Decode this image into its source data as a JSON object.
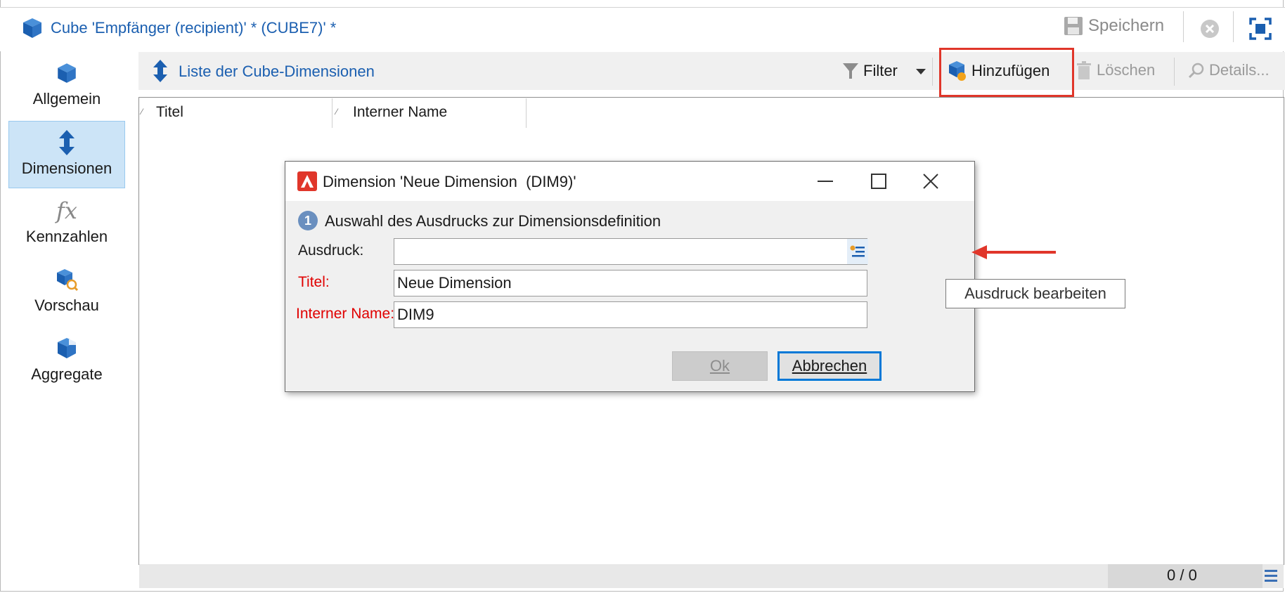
{
  "window": {
    "title": "Cube 'Empfänger (recipient)' * (CUBE7)' *",
    "save_label": "Speichern"
  },
  "nav": {
    "items": [
      {
        "label": "Allgemein",
        "icon": "cube-icon"
      },
      {
        "label": "Dimensionen",
        "icon": "updown-arrow-icon",
        "active": true
      },
      {
        "label": "Kennzahlen",
        "icon": "fx-icon"
      },
      {
        "label": "Vorschau",
        "icon": "cube-search-icon"
      },
      {
        "label": "Aggregate",
        "icon": "cube-aggregate-icon"
      }
    ]
  },
  "toolbar": {
    "list_title": "Liste der Cube-Dimensionen",
    "filter_label": "Filter",
    "add_label": "Hinzufügen",
    "delete_label": "Löschen",
    "details_label": "Details..."
  },
  "table": {
    "columns": [
      "Titel",
      "Interner Name"
    ]
  },
  "status": {
    "count": "0 / 0"
  },
  "dialog": {
    "title": "Dimension 'Neue Dimension  (DIM9)'",
    "step_number": "1",
    "step_text": "Auswahl des Ausdrucks zur Dimensionsdefinition",
    "expression_label": "Ausdruck:",
    "expression_value": "",
    "title_label": "Titel:",
    "title_value": "Neue Dimension",
    "internal_name_label": "Interner Name:",
    "internal_name_value": "DIM9",
    "ok_label": "Ok",
    "cancel_label": "Abbrechen"
  },
  "tooltip": {
    "text": "Ausdruck bearbeiten"
  },
  "colors": {
    "accent_blue": "#1b5fb0",
    "highlight_red": "#e0362a",
    "required_red": "#e00000"
  }
}
